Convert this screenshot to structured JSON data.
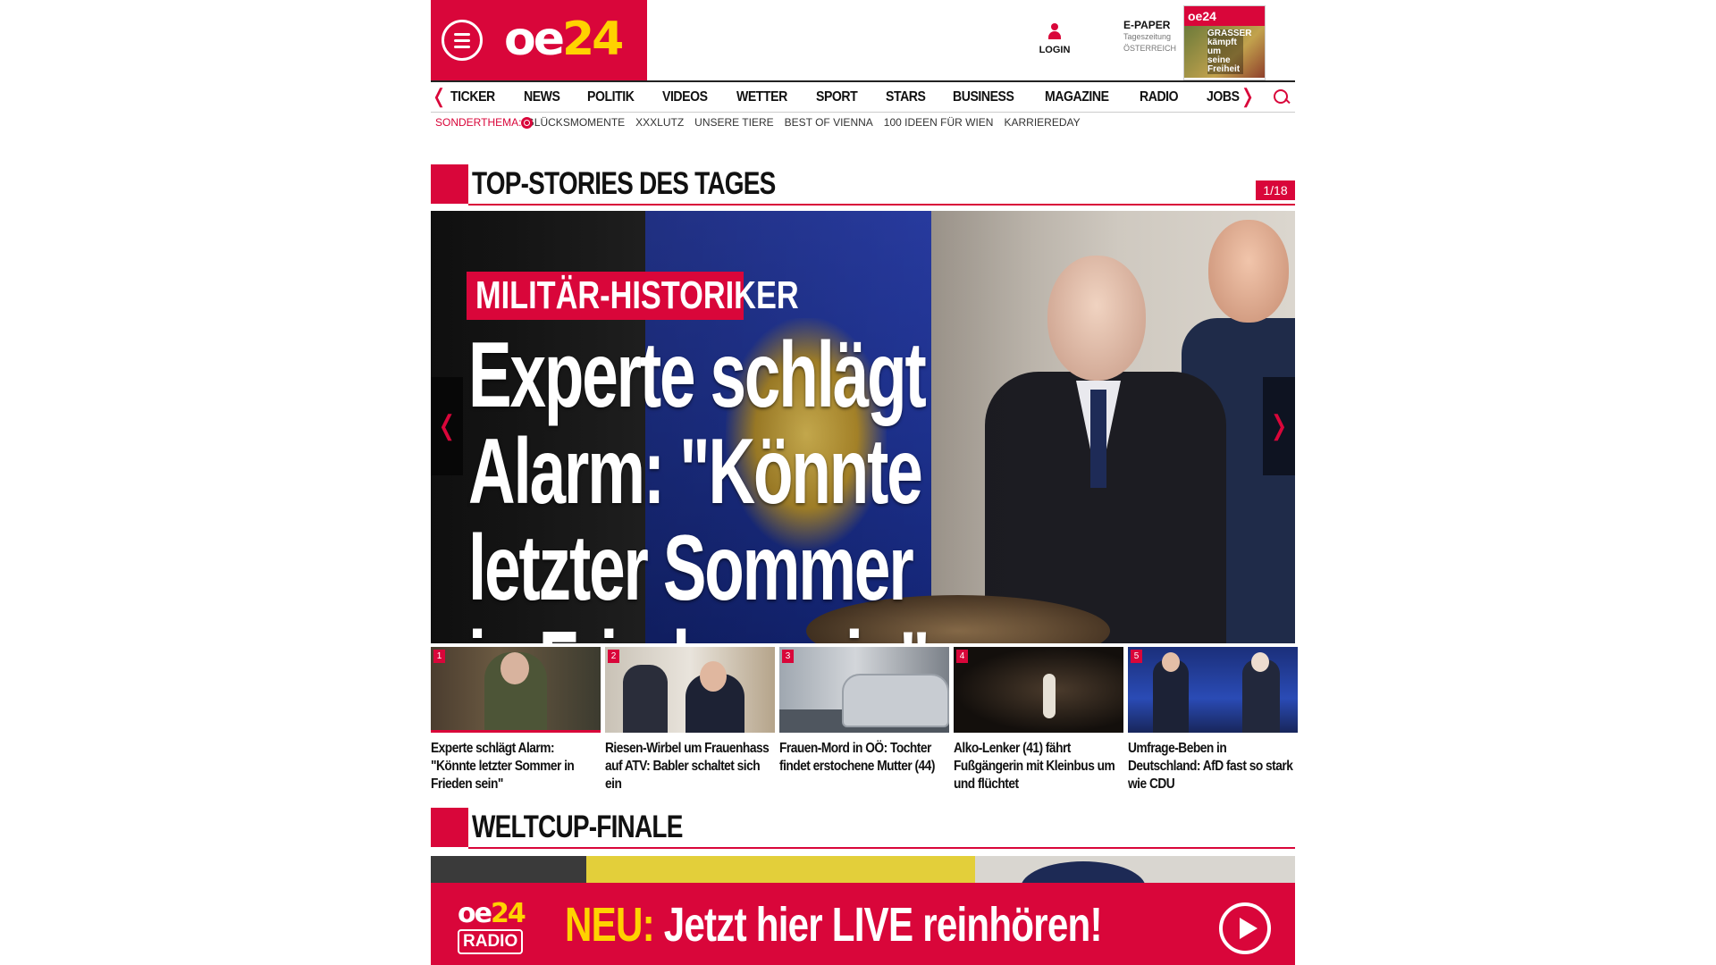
{
  "brand": {
    "logo_main": "oe",
    "logo_accent": "24"
  },
  "header": {
    "login_label": "LOGIN",
    "epaper_title": "E-PAPER",
    "epaper_sub1": "Tageszeitung",
    "epaper_sub2": "ÖSTERREICH",
    "epaper_thumb_brand": "oe24",
    "epaper_thumb_headline": "GRASSER kämpft um seine Freiheit"
  },
  "nav": {
    "items": [
      "TICKER",
      "NEWS",
      "POLITIK",
      "VIDEOS",
      "WETTER",
      "SPORT",
      "STARS",
      "BUSINESS",
      "MAGAZINE",
      "RADIO",
      "JOBS"
    ],
    "prev_icon": "❬",
    "next_icon": "❭"
  },
  "special": {
    "label": "SONDERTHEMA:",
    "items": [
      "GLÜCKSMOMENTE",
      "XXXLUTZ",
      "UNSERE TIERE",
      "BEST OF VIENNA",
      "100 IDEEN FÜR WIEN",
      "KARRIEREDAY"
    ]
  },
  "top_stories": {
    "title": "TOP-STORIES DES TAGES",
    "counter": "1/18",
    "hero": {
      "kicker": "MILITÄR-HISTORIKER",
      "headline": "Experte schlägt Alarm: \"Könnte letzter Sommer in Frieden sein\"",
      "prev_icon": "❬",
      "next_icon": "❭"
    },
    "thumbs": [
      {
        "num": "1",
        "caption": "Experte schlägt Alarm: \"Könnte letzter Sommer in Frieden sein\""
      },
      {
        "num": "2",
        "caption": "Riesen-Wirbel um Frauenhass auf ATV: Babler schaltet sich ein"
      },
      {
        "num": "3",
        "caption": "Frauen-Mord in OÖ: Tochter findet erstochene Mutter (44)"
      },
      {
        "num": "4",
        "caption": "Alko-Lenker (41) fährt Fußgängerin mit Kleinbus um und flüchtet"
      },
      {
        "num": "5",
        "caption": "Umfrage-Beben in Deutschland: AfD fast so stark wie CDU"
      }
    ]
  },
  "weltcup": {
    "title": "WELTCUP-FINALE"
  },
  "radio_banner": {
    "logo_main": "oe",
    "logo_accent": "24",
    "logo_sub": "RADIO",
    "neu": "NEU:",
    "message": " Jetzt hier LIVE reinhören!"
  },
  "colors": {
    "accent": "#d9063a",
    "yellow": "#ffd200"
  }
}
